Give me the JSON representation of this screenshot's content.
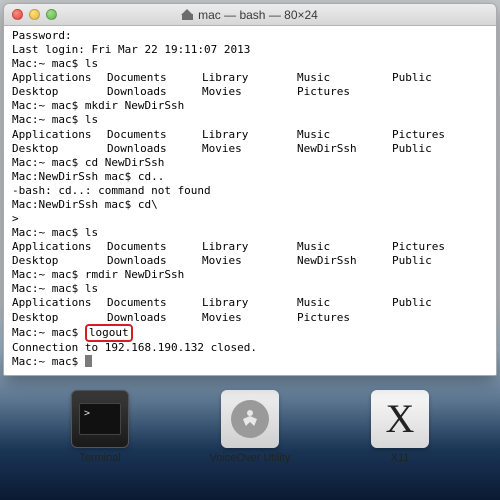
{
  "window": {
    "title": "mac — bash — 80×24"
  },
  "dock": {
    "items": [
      {
        "label": "Terminal"
      },
      {
        "label": "VoiceOver Utility"
      },
      {
        "label": "X11"
      }
    ]
  },
  "term": {
    "password": "Password:",
    "lastlogin": "Last login: Fri Mar 22 19:11:07 2013",
    "prompt_home": "Mac:~ mac$ ",
    "prompt_newdir": "Mac:NewDirSsh mac$ ",
    "cmd_ls": "ls",
    "cmd_mkdir": "mkdir NewDirSsh",
    "cmd_cd_newdir": "cd NewDirSsh",
    "cmd_cd_dotdot": "cd..",
    "cmd_cd_back": "cd\\",
    "cmd_rmdir": "rmdir NewDirSsh",
    "cmd_logout": "logout",
    "bash_err": "-bash: cd..: command not found",
    "gt": ">",
    "connection_closed": "Connection to 192.168.190.132 closed.",
    "dirs1": [
      "Applications",
      "Documents",
      "Library",
      "Music",
      "Public"
    ],
    "dirs2": [
      "Desktop",
      "Downloads",
      "Movies",
      "Pictures",
      ""
    ],
    "dirsA": [
      "Applications",
      "Documents",
      "Library",
      "Music",
      "Pictures"
    ],
    "dirsB": [
      "Desktop",
      "Downloads",
      "Movies",
      "NewDirSsh",
      "Public"
    ]
  }
}
